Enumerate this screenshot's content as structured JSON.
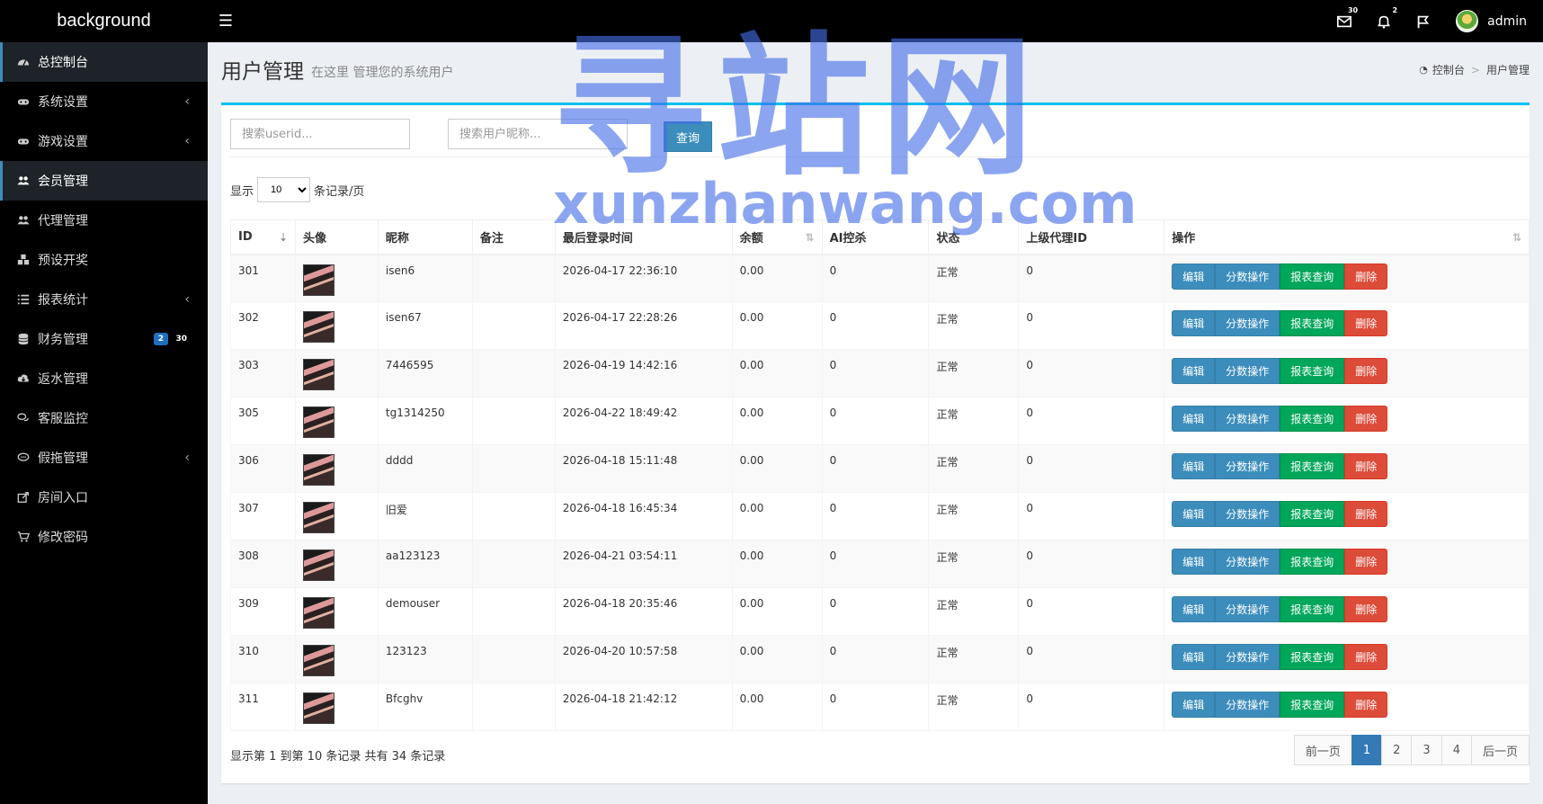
{
  "app": {
    "brand": "background"
  },
  "topbar": {
    "mail_badge": "30",
    "bell_badge": "2",
    "username": "admin"
  },
  "sidebar": {
    "items": [
      {
        "label": "总控制台",
        "icon": "dashboard-icon",
        "arrow": ""
      },
      {
        "label": "系统设置",
        "icon": "gamepad-icon",
        "arrow": "‹"
      },
      {
        "label": "游戏设置",
        "icon": "gamepad-icon",
        "arrow": "‹"
      },
      {
        "label": "会员管理",
        "icon": "users-icon",
        "arrow": ""
      },
      {
        "label": "代理管理",
        "icon": "users-icon",
        "arrow": ""
      },
      {
        "label": "预设开奖",
        "icon": "cubes-icon",
        "arrow": ""
      },
      {
        "label": "报表统计",
        "icon": "list-icon",
        "arrow": "‹"
      },
      {
        "label": "财务管理",
        "icon": "database-icon",
        "arrow": "",
        "badge1": "2",
        "badge2": "30"
      },
      {
        "label": "返水管理",
        "icon": "cloud-download-icon",
        "arrow": ""
      },
      {
        "label": "客服监控",
        "icon": "comments-icon",
        "arrow": ""
      },
      {
        "label": "假拖管理",
        "icon": "comment-icon",
        "arrow": "‹"
      },
      {
        "label": "房间入口",
        "icon": "share-icon",
        "arrow": ""
      },
      {
        "label": "修改密码",
        "icon": "cart-icon",
        "arrow": ""
      }
    ]
  },
  "header": {
    "title": "用户管理",
    "subtitle": "在这里 管理您的系统用户",
    "breadcrumb": [
      "控制台",
      "用户管理"
    ]
  },
  "search": {
    "userid_placeholder": "搜索userid...",
    "nickname_placeholder": "搜索用户昵称...",
    "query_label": "查询"
  },
  "length": {
    "prefix": "显示",
    "selected": "10",
    "suffix": "条记录/页"
  },
  "table": {
    "columns": [
      "ID",
      "头像",
      "昵称",
      "备注",
      "最后登录时间",
      "余额",
      "AI控杀",
      "状态",
      "上级代理ID",
      "操作"
    ],
    "actions": {
      "edit": "编辑",
      "score": "分数操作",
      "report": "报表查询",
      "delete": "删除"
    },
    "rows": [
      {
        "id": "301",
        "nickname": "isen6",
        "note": "",
        "last_login": "2026-04-17 22:36:10",
        "balance": "0.00",
        "ai": "0",
        "status": "正常",
        "parent": "0"
      },
      {
        "id": "302",
        "nickname": "isen67",
        "note": "",
        "last_login": "2026-04-17 22:28:26",
        "balance": "0.00",
        "ai": "0",
        "status": "正常",
        "parent": "0"
      },
      {
        "id": "303",
        "nickname": "7446595",
        "note": "",
        "last_login": "2026-04-19 14:42:16",
        "balance": "0.00",
        "ai": "0",
        "status": "正常",
        "parent": "0"
      },
      {
        "id": "305",
        "nickname": "tg1314250",
        "note": "",
        "last_login": "2026-04-22 18:49:42",
        "balance": "0.00",
        "ai": "0",
        "status": "正常",
        "parent": "0"
      },
      {
        "id": "306",
        "nickname": "dddd",
        "note": "",
        "last_login": "2026-04-18 15:11:48",
        "balance": "0.00",
        "ai": "0",
        "status": "正常",
        "parent": "0"
      },
      {
        "id": "307",
        "nickname": "旧爱",
        "note": "",
        "last_login": "2026-04-18 16:45:34",
        "balance": "0.00",
        "ai": "0",
        "status": "正常",
        "parent": "0"
      },
      {
        "id": "308",
        "nickname": "aa123123",
        "note": "",
        "last_login": "2026-04-21 03:54:11",
        "balance": "0.00",
        "ai": "0",
        "status": "正常",
        "parent": "0"
      },
      {
        "id": "309",
        "nickname": "demouser",
        "note": "",
        "last_login": "2026-04-18 20:35:46",
        "balance": "0.00",
        "ai": "0",
        "status": "正常",
        "parent": "0"
      },
      {
        "id": "310",
        "nickname": "123123",
        "note": "",
        "last_login": "2026-04-20 10:57:58",
        "balance": "0.00",
        "ai": "0",
        "status": "正常",
        "parent": "0"
      },
      {
        "id": "311",
        "nickname": "Bfcghv",
        "note": "",
        "last_login": "2026-04-18 21:42:12",
        "balance": "0.00",
        "ai": "0",
        "status": "正常",
        "parent": "0"
      }
    ]
  },
  "footer": {
    "info": "显示第 1 到第 10 条记录 共有 34 条记录",
    "pagination": {
      "prev": "前一页",
      "pages": [
        "1",
        "2",
        "3",
        "4"
      ],
      "active": "1",
      "next": "后一页"
    }
  },
  "watermark": {
    "big": "寻站网",
    "small": "xunzhanwang.com"
  }
}
